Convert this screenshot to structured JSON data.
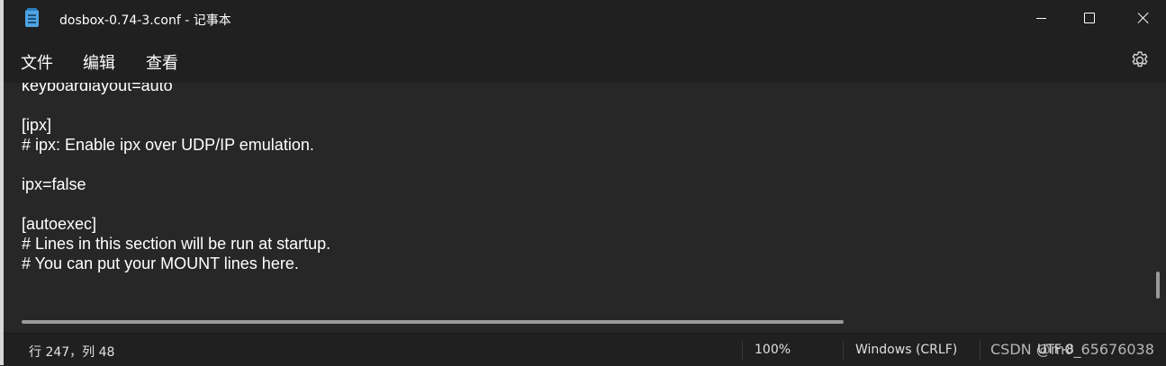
{
  "window": {
    "title": "dosbox-0.74-3.conf - 记事本",
    "app_icon": "notepad-icon",
    "controls": {
      "minimize_icon": "minimize-icon",
      "maximize_icon": "maximize-icon",
      "close_icon": "close-icon"
    }
  },
  "menubar": {
    "items": [
      {
        "label": "文件"
      },
      {
        "label": "编辑"
      },
      {
        "label": "查看"
      }
    ],
    "settings_icon": "gear-icon"
  },
  "editor": {
    "lines": [
      "keyboardlayout=auto",
      "",
      "[ipx]",
      "# ipx: Enable ipx over UDP/IP emulation.",
      "",
      "ipx=false",
      "",
      "[autoexec]",
      "# Lines in this section will be run at startup.",
      "# You can put your MOUNT lines here."
    ]
  },
  "statusbar": {
    "position": "行 247，列 48",
    "zoom": "100%",
    "line_ending": "Windows (CRLF)",
    "encoding": "UTF-8"
  },
  "watermark": "CSDN @m0_65676038",
  "colors": {
    "background": "#272727",
    "chrome": "#202020",
    "text": "#ffffff",
    "accent_icon": "#4ea4e3"
  }
}
